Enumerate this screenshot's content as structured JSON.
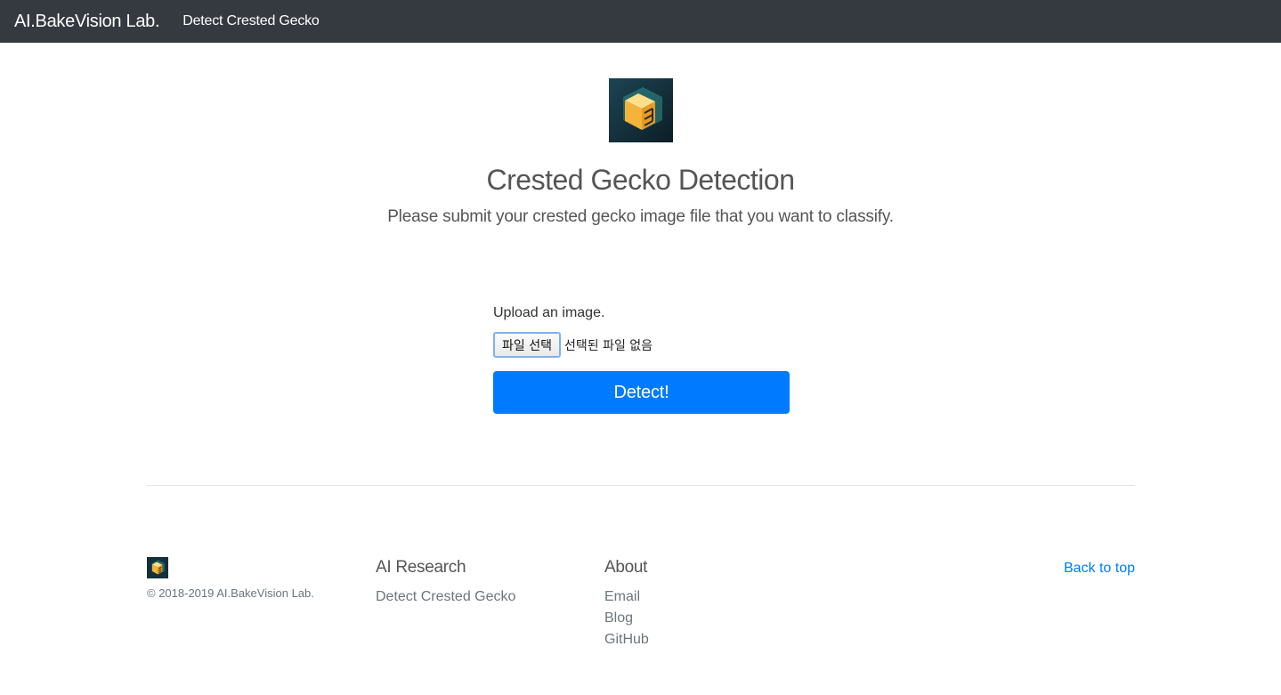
{
  "navbar": {
    "brand": "AI.BakeVision Lab.",
    "link": "Detect Crested Gecko"
  },
  "hero": {
    "logo_icon": "isometric-cube-logo-icon",
    "title": "Crested Gecko Detection",
    "lead": "Please submit your crested gecko image file that you want to classify."
  },
  "form": {
    "label": "Upload an image.",
    "file_button": "파일 선택",
    "file_status": "선택된 파일 없음",
    "submit": "Detect!"
  },
  "footer": {
    "logo_icon": "isometric-cube-logo-icon",
    "copyright": "© 2018-2019 AI.BakeVision Lab.",
    "research": {
      "heading": "AI Research",
      "links": [
        "Detect Crested Gecko"
      ]
    },
    "about": {
      "heading": "About",
      "links": [
        "Email",
        "Blog",
        "GitHub"
      ]
    },
    "back_to_top": "Back to top"
  },
  "colors": {
    "navbar_bg": "#343a40",
    "primary": "#007bff",
    "heading_text": "#555555",
    "muted_text": "#6c757d",
    "logo_bg": "#14303a",
    "logo_cube": "#f2c24a"
  }
}
